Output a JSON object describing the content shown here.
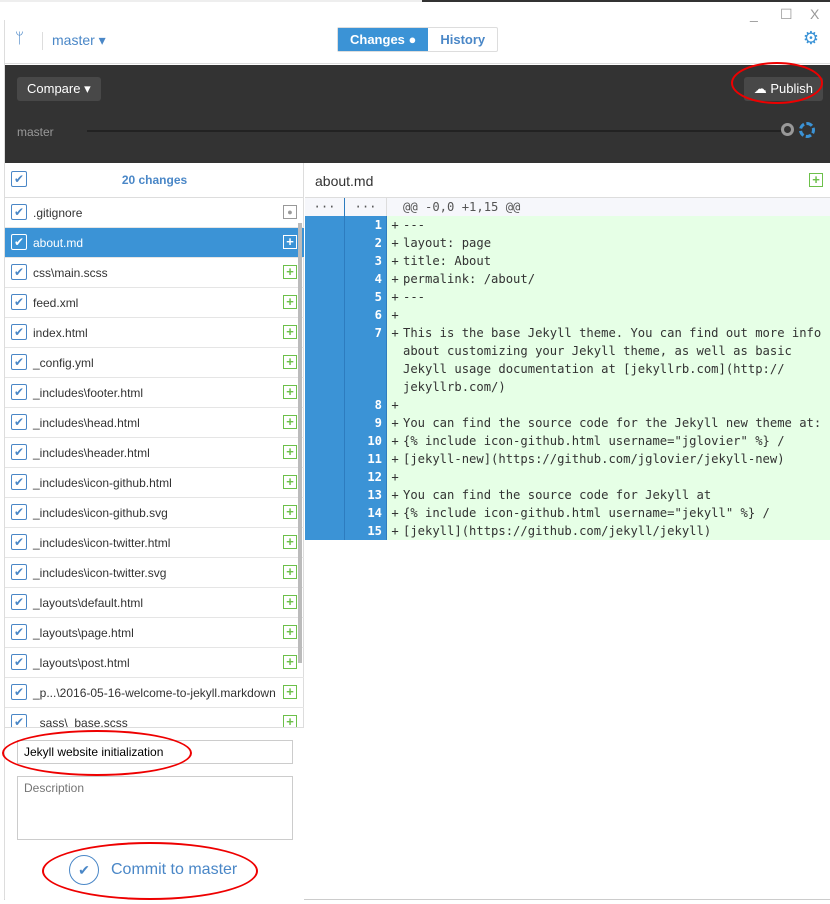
{
  "window": {
    "minimize": "_",
    "maximize": "☐",
    "close": "X"
  },
  "header": {
    "branch": "master ▾",
    "tabs": [
      {
        "label": "Changes ●",
        "active": true
      },
      {
        "label": "History",
        "active": false
      }
    ]
  },
  "toolbar": {
    "compare": "Compare ▾",
    "publish": "Publish",
    "timeline_branch": "master"
  },
  "changes": {
    "count": "20 changes",
    "files": [
      {
        "name": ".gitignore",
        "status": "modified",
        "selected": false
      },
      {
        "name": "about.md",
        "status": "added",
        "selected": true
      },
      {
        "name": "css\\main.scss",
        "status": "added",
        "selected": false
      },
      {
        "name": "feed.xml",
        "status": "added",
        "selected": false
      },
      {
        "name": "index.html",
        "status": "added",
        "selected": false
      },
      {
        "name": "_config.yml",
        "status": "added",
        "selected": false
      },
      {
        "name": "_includes\\footer.html",
        "status": "added",
        "selected": false
      },
      {
        "name": "_includes\\head.html",
        "status": "added",
        "selected": false
      },
      {
        "name": "_includes\\header.html",
        "status": "added",
        "selected": false
      },
      {
        "name": "_includes\\icon-github.html",
        "status": "added",
        "selected": false
      },
      {
        "name": "_includes\\icon-github.svg",
        "status": "added",
        "selected": false
      },
      {
        "name": "_includes\\icon-twitter.html",
        "status": "added",
        "selected": false
      },
      {
        "name": "_includes\\icon-twitter.svg",
        "status": "added",
        "selected": false
      },
      {
        "name": "_layouts\\default.html",
        "status": "added",
        "selected": false
      },
      {
        "name": "_layouts\\page.html",
        "status": "added",
        "selected": false
      },
      {
        "name": "_layouts\\post.html",
        "status": "added",
        "selected": false
      },
      {
        "name": "_p...\\2016-05-16-welcome-to-jekyll.markdown",
        "status": "added",
        "selected": false
      },
      {
        "name": "_sass\\_base.scss",
        "status": "added",
        "selected": false
      }
    ]
  },
  "commit": {
    "summary": "Jekyll website initialization",
    "description_placeholder": "Description",
    "button": "Commit to master"
  },
  "diff": {
    "file": "about.md",
    "hunk_old": "···",
    "hunk_new": "···",
    "hunk": "@@ -0,0 +1,15 @@",
    "lines": [
      {
        "n": "1",
        "text": "---"
      },
      {
        "n": "2",
        "text": "layout: page"
      },
      {
        "n": "3",
        "text": "title: About"
      },
      {
        "n": "4",
        "text": "permalink: /about/"
      },
      {
        "n": "5",
        "text": "---"
      },
      {
        "n": "6",
        "text": ""
      },
      {
        "n": "7",
        "text": "This is the base Jekyll theme. You can find out more info about customizing your Jekyll theme, as well as basic Jekyll usage documentation at [jekyllrb.com](http:// jekyllrb.com/)"
      },
      {
        "n": "8",
        "text": ""
      },
      {
        "n": "9",
        "text": "You can find the source code for the Jekyll new theme at:"
      },
      {
        "n": "10",
        "text": "{% include icon-github.html username=\"jglovier\" %} /"
      },
      {
        "n": "11",
        "text": "[jekyll-new](https://github.com/jglovier/jekyll-new)"
      },
      {
        "n": "12",
        "text": ""
      },
      {
        "n": "13",
        "text": "You can find the source code for Jekyll at"
      },
      {
        "n": "14",
        "text": "{% include icon-github.html username=\"jekyll\" %} /"
      },
      {
        "n": "15",
        "text": "[jekyll](https://github.com/jekyll/jekyll)"
      }
    ]
  },
  "colors": {
    "accent": "#3b93d6",
    "added": "#6cc04a",
    "added_bg": "#e6ffe6",
    "toolbar_bg": "#333333",
    "annotation": "#e00000"
  }
}
